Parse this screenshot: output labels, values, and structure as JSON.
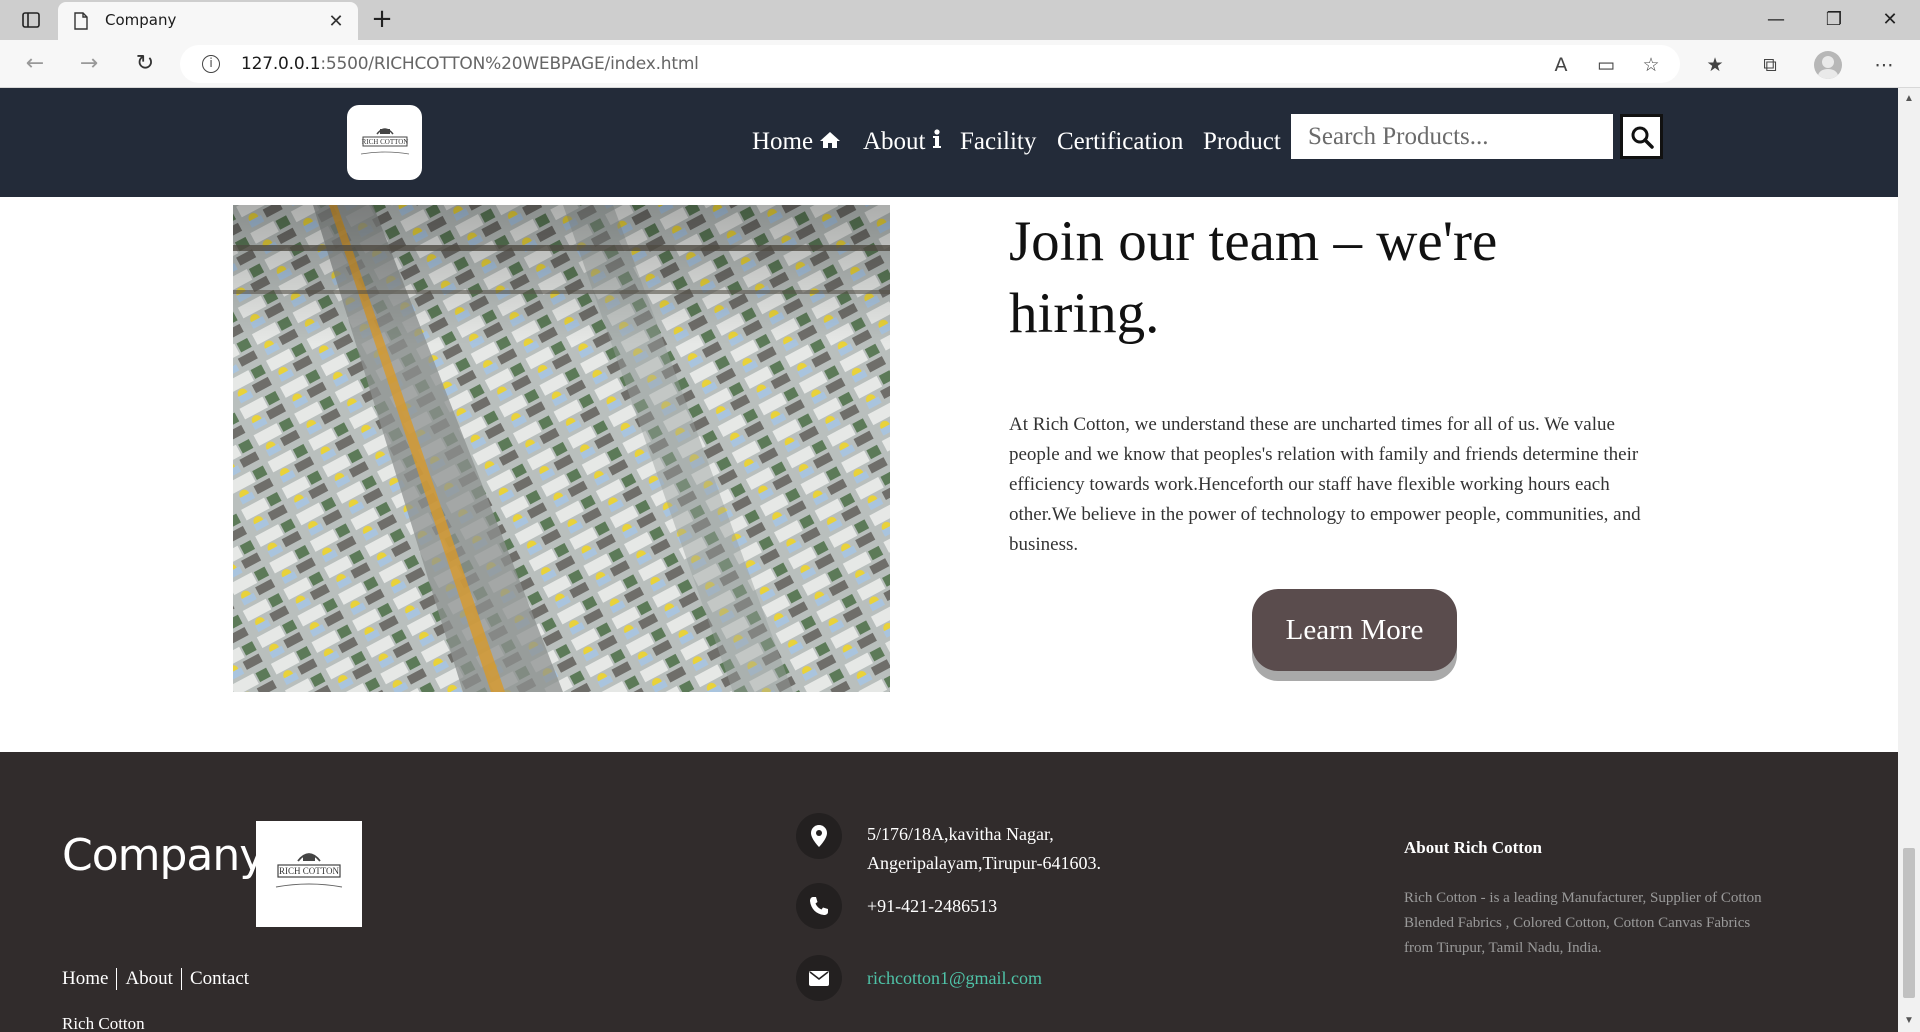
{
  "browser": {
    "tab_title": "Company",
    "url_host": "127.0.0.1",
    "url_rest": ":5500/RICHCOTTON%20WEBPAGE/index.html"
  },
  "header": {
    "logo_text": "RICH COTTON",
    "nav": [
      {
        "label": "Home",
        "icon": "home-icon"
      },
      {
        "label": "About",
        "icon": "info-icon"
      },
      {
        "label": "Facility"
      },
      {
        "label": "Certification"
      },
      {
        "label": "Product"
      }
    ],
    "search_placeholder": "Search Products...",
    "search_icon": "search-icon"
  },
  "hero": {
    "headline": "Join our team – we're hiring.",
    "body": "At Rich Cotton, we understand these are uncharted times for all of us. We value people and we know that peoples's relation with family and friends determine their efficiency towards work.Henceforth our staff have flexible working hours each other.We believe in the power of technology to empower people, communities, and business.",
    "cta_label": "Learn More"
  },
  "footer": {
    "company": "Company",
    "logo_text": "RICH COTTON",
    "links": [
      "Home",
      "About",
      "Contact"
    ],
    "name": "Rich Cotton",
    "address_line1": "5/176/18A,kavitha Nagar,",
    "address_line2": "Angeripalayam,Tirupur-641603.",
    "phone": "+91-421-2486513",
    "email": "richcotton1@gmail.com",
    "about_title": "About Rich Cotton",
    "about_text": "Rich Cotton - is a leading Manufacturer, Supplier of Cotton Blended Fabrics , Colored Cotton, Cotton Canvas Fabrics from Tirupur, Tamil Nadu, India."
  },
  "colors": {
    "header_bg": "#232b39",
    "footer_bg": "#312c2c",
    "button_bg": "#5a4c4d",
    "email_link": "#4fc3a8"
  }
}
